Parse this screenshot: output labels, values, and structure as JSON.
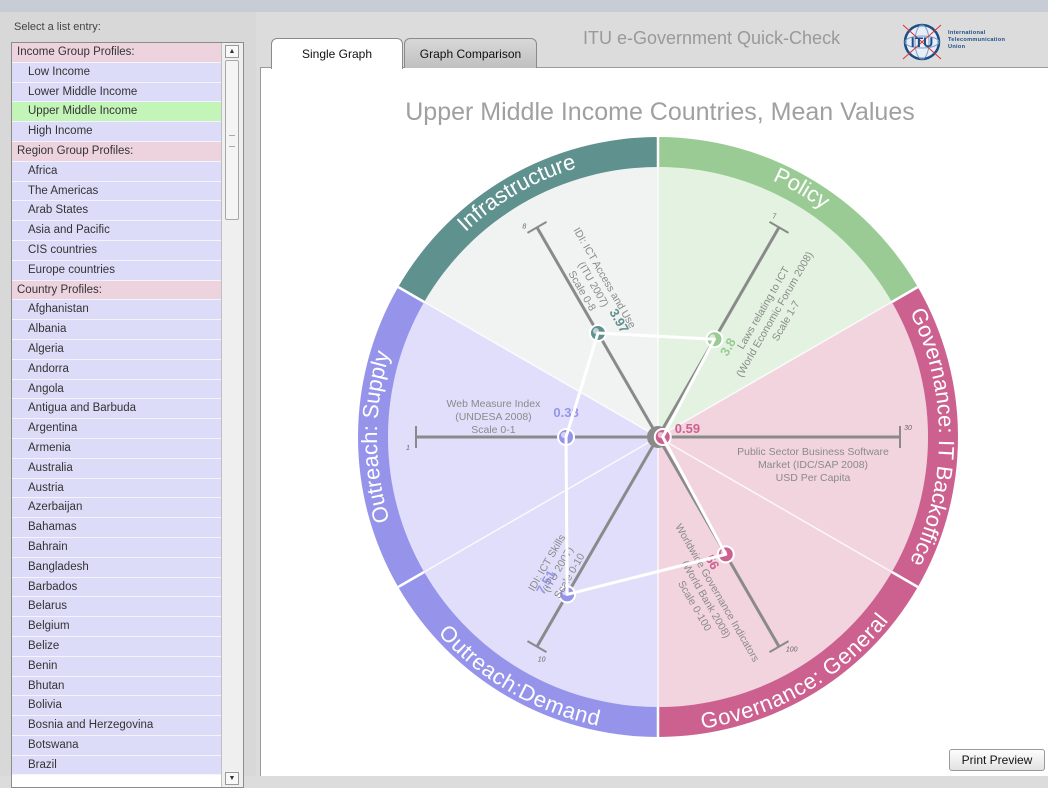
{
  "sidebar": {
    "select_label": "Select a list entry:",
    "items": [
      {
        "label": "Income Group Profiles:",
        "type": "header"
      },
      {
        "label": "Low Income",
        "type": "item"
      },
      {
        "label": "Lower Middle Income",
        "type": "item"
      },
      {
        "label": "Upper Middle Income",
        "type": "item",
        "selected": true
      },
      {
        "label": "High Income",
        "type": "item"
      },
      {
        "label": "Region Group Profiles:",
        "type": "header"
      },
      {
        "label": "Africa",
        "type": "item"
      },
      {
        "label": "The Americas",
        "type": "item"
      },
      {
        "label": "Arab States",
        "type": "item"
      },
      {
        "label": "Asia and Pacific",
        "type": "item"
      },
      {
        "label": "CIS countries",
        "type": "item"
      },
      {
        "label": "Europe countries",
        "type": "item"
      },
      {
        "label": "Country Profiles:",
        "type": "header"
      },
      {
        "label": "Afghanistan",
        "type": "item"
      },
      {
        "label": "Albania",
        "type": "item"
      },
      {
        "label": "Algeria",
        "type": "item"
      },
      {
        "label": "Andorra",
        "type": "item"
      },
      {
        "label": "Angola",
        "type": "item"
      },
      {
        "label": "Antigua and Barbuda",
        "type": "item"
      },
      {
        "label": "Argentina",
        "type": "item"
      },
      {
        "label": "Armenia",
        "type": "item"
      },
      {
        "label": "Australia",
        "type": "item"
      },
      {
        "label": "Austria",
        "type": "item"
      },
      {
        "label": "Azerbaijan",
        "type": "item"
      },
      {
        "label": "Bahamas",
        "type": "item"
      },
      {
        "label": "Bahrain",
        "type": "item"
      },
      {
        "label": "Bangladesh",
        "type": "item"
      },
      {
        "label": "Barbados",
        "type": "item"
      },
      {
        "label": "Belarus",
        "type": "item"
      },
      {
        "label": "Belgium",
        "type": "item"
      },
      {
        "label": "Belize",
        "type": "item"
      },
      {
        "label": "Benin",
        "type": "item"
      },
      {
        "label": "Bhutan",
        "type": "item"
      },
      {
        "label": "Bolivia",
        "type": "item"
      },
      {
        "label": "Bosnia and Herzegovina",
        "type": "item"
      },
      {
        "label": "Botswana",
        "type": "item"
      },
      {
        "label": "Brazil",
        "type": "item"
      }
    ],
    "colors": {
      "header": "#edd3de",
      "item": "#dcdcf8",
      "selected": "#c4f5b8"
    }
  },
  "tabs": [
    {
      "label": "Single Graph",
      "active": true
    },
    {
      "label": "Graph Comparison",
      "active": false
    }
  ],
  "header": {
    "app_title": "ITU e-Government Quick-Check",
    "org_lines": [
      "International",
      "Telecommunication",
      "Union"
    ],
    "logo_text": "ITU"
  },
  "print_button": "Print Preview",
  "chart_data": {
    "type": "radar",
    "title": "Upper Middle Income Countries, Mean Values",
    "sectors": [
      {
        "name": "Policy",
        "color": "#9acb94",
        "fill": "#e4f3e1"
      },
      {
        "name": "Governance: IT Backoffice",
        "color": "#cc6190",
        "fill": "#f2d4df"
      },
      {
        "name": "Governance: General",
        "color": "#cc6190",
        "fill": "#f2d4df"
      },
      {
        "name": "Outreach:Demand",
        "color": "#9694ea",
        "fill": "#e0defa"
      },
      {
        "name": "Outreach: Supply",
        "color": "#9694ea",
        "fill": "#e0defa"
      },
      {
        "name": "Infrastructure",
        "color": "#5f918e",
        "fill": "#f1f3f2"
      }
    ],
    "axes": [
      {
        "label_lines": [
          "Laws relating to ICT",
          "(World Economic Forum 2008)",
          "Scale 1-7"
        ],
        "min": 1,
        "max": 7,
        "value": 3.8,
        "value_label": "3.8",
        "min_label": "",
        "max_label": "7",
        "color": "#9acb94"
      },
      {
        "label_lines": [
          "Public Sector Business Software",
          "Market (IDC/SAP 2008)",
          "USD Per Capita"
        ],
        "min": 0,
        "max": 30,
        "value": 0.59,
        "value_label": "0.59",
        "min_label": "",
        "max_label": "30",
        "color": "#cc6190"
      },
      {
        "label_lines": [
          "Worldwide Governance Indicators",
          "(World Bank 2008)",
          "Scale 0-100"
        ],
        "min": 0,
        "max": 100,
        "value": 56,
        "value_label": "56",
        "min_label": "",
        "max_label": "100",
        "color": "#cc6190"
      },
      {
        "label_lines": [
          "IDI: ICT Skills",
          "(ITU 2007)",
          "Scale 0-10"
        ],
        "min": 0,
        "max": 10,
        "value": 7.51,
        "value_label": "7.51",
        "min_label": "",
        "max_label": "10",
        "color": "#9694ea"
      },
      {
        "label_lines": [
          "Web Measure Index",
          "(UNDESA 2008)",
          "Scale 0-1"
        ],
        "min": 0,
        "max": 1,
        "value": 0.38,
        "value_label": "0.38",
        "min_label": "",
        "max_label": "1",
        "color": "#9694ea"
      },
      {
        "label_lines": [
          "IDI: ICT Access and Use",
          "(ITU 2007)",
          "Scale 0-8"
        ],
        "min": 0,
        "max": 8,
        "value": 3.97,
        "value_label": "3.97",
        "min_label": "",
        "max_label": "8",
        "color": "#5f918e"
      }
    ]
  }
}
